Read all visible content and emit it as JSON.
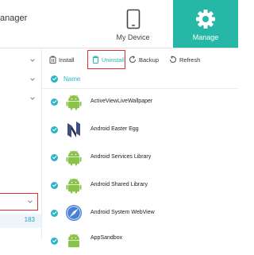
{
  "app": {
    "title": "anager"
  },
  "header": {
    "tabs": [
      {
        "label": "My Device",
        "icon": "phone-icon",
        "active": false
      },
      {
        "label": "Manage",
        "icon": "gear-icon",
        "active": true
      }
    ],
    "accent": "#26b7a6"
  },
  "sidebar": {
    "selected_count": "183"
  },
  "toolbar": {
    "install": "Install",
    "uninstall": "Uninstall",
    "backup": "Backup",
    "refresh": "Refresh"
  },
  "table": {
    "column": "Name",
    "rows": [
      {
        "name": "ActiveViewLiveWallpaper",
        "icon": "android-icon",
        "checked": true
      },
      {
        "name": "Android Easter Egg",
        "icon": "nougat-icon",
        "checked": true
      },
      {
        "name": "Android Services Library",
        "icon": "android-icon",
        "checked": true
      },
      {
        "name": "Android Shared Library",
        "icon": "android-icon",
        "checked": true
      },
      {
        "name": "Android System WebView",
        "icon": "webview-compass-icon",
        "checked": true
      },
      {
        "name": "AppSandbox",
        "icon": "android-icon",
        "checked": true
      }
    ]
  },
  "colors": {
    "highlight_border": "#e03030",
    "check": "#2cb3c9",
    "android_green": "#8bc34a"
  }
}
